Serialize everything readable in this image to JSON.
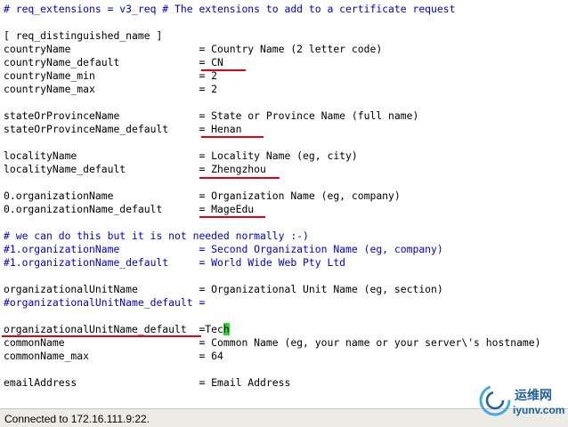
{
  "terminal": {
    "lines": [
      "# req_extensions = v3_req # The extensions to add to a certificate request",
      "",
      "[ req_distinguished_name ]",
      "countryName                     = Country Name (2 letter code)",
      "countryName_default             = CN",
      "countryName_min                 = 2",
      "countryName_max                 = 2",
      "",
      "stateOrProvinceName             = State or Province Name (full name)",
      "stateOrProvinceName_default     = Henan",
      "",
      "localityName                    = Locality Name (eg, city)",
      "localityName_default            = Zhengzhou",
      "",
      "0.organizationName              = Organization Name (eg, company)",
      "0.organizationName_default      = MageEdu",
      "",
      "# we can do this but it is not needed normally :-)",
      "#1.organizationName             = Second Organization Name (eg, company)",
      "#1.organizationName_default     = World Wide Web Pty Ltd",
      "",
      "organizationalUnitName          = Organizational Unit Name (eg, section)",
      "#organizationalUnitName_default =",
      "",
      "organizationalUnitName_default  =Tec",
      "commonName                      = Common Name (eg, your name or your server\\'s hostname)",
      "commonName_max                  = 64",
      "",
      "emailAddress                    = Email Address"
    ],
    "cursor_char": "h",
    "colors": {
      "text": "#000000",
      "comment": "#0000cc",
      "underline": "#e0001a",
      "cursor": "#22dd22"
    }
  },
  "status_bar": {
    "text": "Connected to 172.16.111.9:22."
  },
  "watermark": {
    "text_cn": "运维网",
    "text_url": "iyunv.com"
  }
}
